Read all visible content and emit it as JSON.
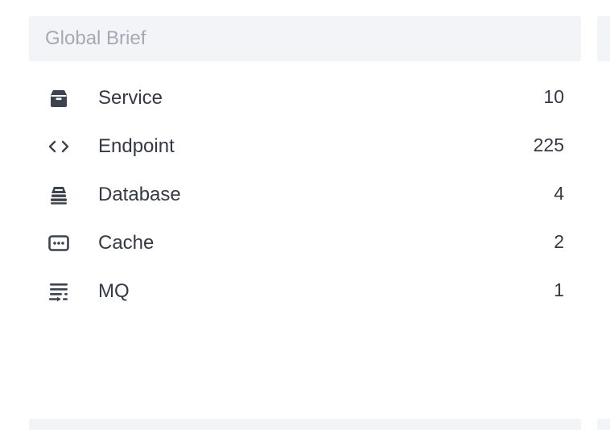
{
  "panel": {
    "title": "Global Brief",
    "items": [
      {
        "icon": "service-icon",
        "label": "Service",
        "count": "10"
      },
      {
        "icon": "endpoint-icon",
        "label": "Endpoint",
        "count": "225"
      },
      {
        "icon": "database-icon",
        "label": "Database",
        "count": "4"
      },
      {
        "icon": "cache-icon",
        "label": "Cache",
        "count": "2"
      },
      {
        "icon": "mq-icon",
        "label": "MQ",
        "count": "1"
      }
    ]
  },
  "colors": {
    "header_background": "#f3f4f8",
    "header_text": "#a4aab5",
    "body_text": "#333a44"
  }
}
